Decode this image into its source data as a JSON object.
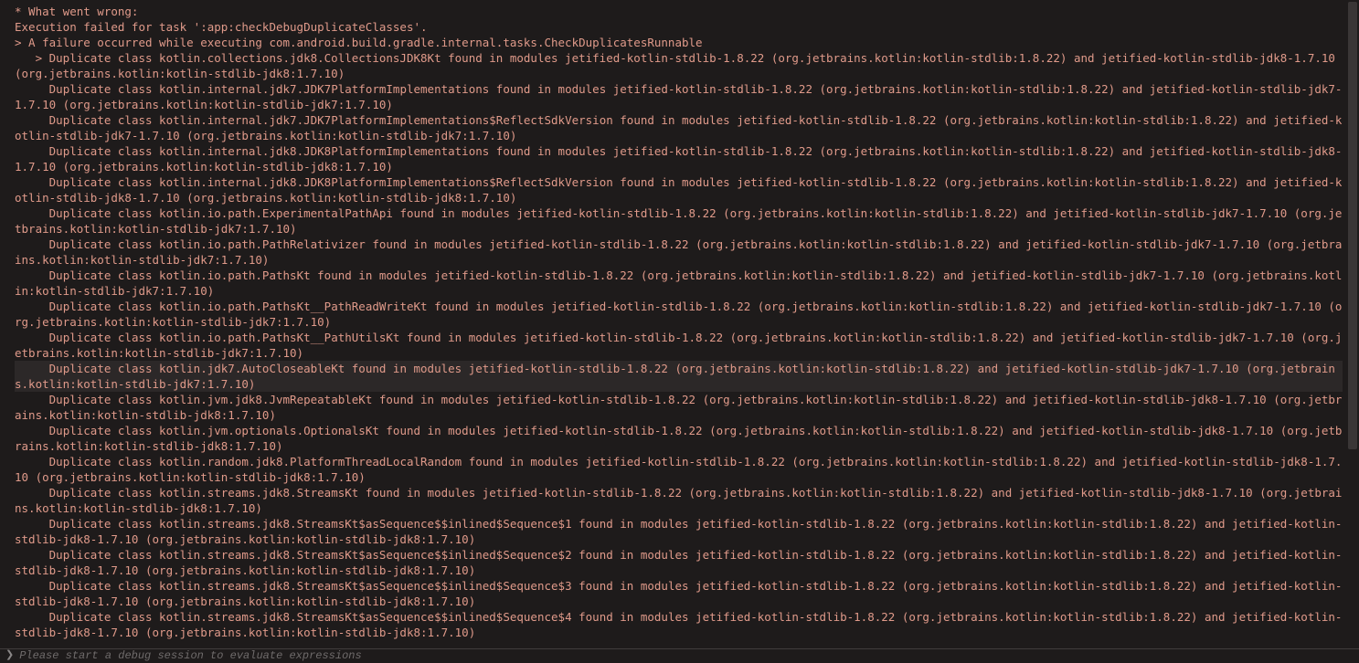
{
  "log": {
    "lines": [
      "* What went wrong:",
      "Execution failed for task ':app:checkDebugDuplicateClasses'.",
      "> A failure occurred while executing com.android.build.gradle.internal.tasks.CheckDuplicatesRunnable",
      "   > Duplicate class kotlin.collections.jdk8.CollectionsJDK8Kt found in modules jetified-kotlin-stdlib-1.8.22 (org.jetbrains.kotlin:kotlin-stdlib:1.8.22) and jetified-kotlin-stdlib-jdk8-1.7.10 (org.jetbrains.kotlin:kotlin-stdlib-jdk8:1.7.10)",
      "     Duplicate class kotlin.internal.jdk7.JDK7PlatformImplementations found in modules jetified-kotlin-stdlib-1.8.22 (org.jetbrains.kotlin:kotlin-stdlib:1.8.22) and jetified-kotlin-stdlib-jdk7-1.7.10 (org.jetbrains.kotlin:kotlin-stdlib-jdk7:1.7.10)",
      "     Duplicate class kotlin.internal.jdk7.JDK7PlatformImplementations$ReflectSdkVersion found in modules jetified-kotlin-stdlib-1.8.22 (org.jetbrains.kotlin:kotlin-stdlib:1.8.22) and jetified-kotlin-stdlib-jdk7-1.7.10 (org.jetbrains.kotlin:kotlin-stdlib-jdk7:1.7.10)",
      "     Duplicate class kotlin.internal.jdk8.JDK8PlatformImplementations found in modules jetified-kotlin-stdlib-1.8.22 (org.jetbrains.kotlin:kotlin-stdlib:1.8.22) and jetified-kotlin-stdlib-jdk8-1.7.10 (org.jetbrains.kotlin:kotlin-stdlib-jdk8:1.7.10)",
      "     Duplicate class kotlin.internal.jdk8.JDK8PlatformImplementations$ReflectSdkVersion found in modules jetified-kotlin-stdlib-1.8.22 (org.jetbrains.kotlin:kotlin-stdlib:1.8.22) and jetified-kotlin-stdlib-jdk8-1.7.10 (org.jetbrains.kotlin:kotlin-stdlib-jdk8:1.7.10)",
      "     Duplicate class kotlin.io.path.ExperimentalPathApi found in modules jetified-kotlin-stdlib-1.8.22 (org.jetbrains.kotlin:kotlin-stdlib:1.8.22) and jetified-kotlin-stdlib-jdk7-1.7.10 (org.jetbrains.kotlin:kotlin-stdlib-jdk7:1.7.10)",
      "     Duplicate class kotlin.io.path.PathRelativizer found in modules jetified-kotlin-stdlib-1.8.22 (org.jetbrains.kotlin:kotlin-stdlib:1.8.22) and jetified-kotlin-stdlib-jdk7-1.7.10 (org.jetbrains.kotlin:kotlin-stdlib-jdk7:1.7.10)",
      "     Duplicate class kotlin.io.path.PathsKt found in modules jetified-kotlin-stdlib-1.8.22 (org.jetbrains.kotlin:kotlin-stdlib:1.8.22) and jetified-kotlin-stdlib-jdk7-1.7.10 (org.jetbrains.kotlin:kotlin-stdlib-jdk7:1.7.10)",
      "     Duplicate class kotlin.io.path.PathsKt__PathReadWriteKt found in modules jetified-kotlin-stdlib-1.8.22 (org.jetbrains.kotlin:kotlin-stdlib:1.8.22) and jetified-kotlin-stdlib-jdk7-1.7.10 (org.jetbrains.kotlin:kotlin-stdlib-jdk7:1.7.10)",
      "     Duplicate class kotlin.io.path.PathsKt__PathUtilsKt found in modules jetified-kotlin-stdlib-1.8.22 (org.jetbrains.kotlin:kotlin-stdlib:1.8.22) and jetified-kotlin-stdlib-jdk7-1.7.10 (org.jetbrains.kotlin:kotlin-stdlib-jdk7:1.7.10)",
      "     Duplicate class kotlin.jdk7.AutoCloseableKt found in modules jetified-kotlin-stdlib-1.8.22 (org.jetbrains.kotlin:kotlin-stdlib:1.8.22) and jetified-kotlin-stdlib-jdk7-1.7.10 (org.jetbrains.kotlin:kotlin-stdlib-jdk7:1.7.10)",
      "     Duplicate class kotlin.jvm.jdk8.JvmRepeatableKt found in modules jetified-kotlin-stdlib-1.8.22 (org.jetbrains.kotlin:kotlin-stdlib:1.8.22) and jetified-kotlin-stdlib-jdk8-1.7.10 (org.jetbrains.kotlin:kotlin-stdlib-jdk8:1.7.10)",
      "     Duplicate class kotlin.jvm.optionals.OptionalsKt found in modules jetified-kotlin-stdlib-1.8.22 (org.jetbrains.kotlin:kotlin-stdlib:1.8.22) and jetified-kotlin-stdlib-jdk8-1.7.10 (org.jetbrains.kotlin:kotlin-stdlib-jdk8:1.7.10)",
      "     Duplicate class kotlin.random.jdk8.PlatformThreadLocalRandom found in modules jetified-kotlin-stdlib-1.8.22 (org.jetbrains.kotlin:kotlin-stdlib:1.8.22) and jetified-kotlin-stdlib-jdk8-1.7.10 (org.jetbrains.kotlin:kotlin-stdlib-jdk8:1.7.10)",
      "     Duplicate class kotlin.streams.jdk8.StreamsKt found in modules jetified-kotlin-stdlib-1.8.22 (org.jetbrains.kotlin:kotlin-stdlib:1.8.22) and jetified-kotlin-stdlib-jdk8-1.7.10 (org.jetbrains.kotlin:kotlin-stdlib-jdk8:1.7.10)",
      "     Duplicate class kotlin.streams.jdk8.StreamsKt$asSequence$$inlined$Sequence$1 found in modules jetified-kotlin-stdlib-1.8.22 (org.jetbrains.kotlin:kotlin-stdlib:1.8.22) and jetified-kotlin-stdlib-jdk8-1.7.10 (org.jetbrains.kotlin:kotlin-stdlib-jdk8:1.7.10)",
      "     Duplicate class kotlin.streams.jdk8.StreamsKt$asSequence$$inlined$Sequence$2 found in modules jetified-kotlin-stdlib-1.8.22 (org.jetbrains.kotlin:kotlin-stdlib:1.8.22) and jetified-kotlin-stdlib-jdk8-1.7.10 (org.jetbrains.kotlin:kotlin-stdlib-jdk8:1.7.10)",
      "     Duplicate class kotlin.streams.jdk8.StreamsKt$asSequence$$inlined$Sequence$3 found in modules jetified-kotlin-stdlib-1.8.22 (org.jetbrains.kotlin:kotlin-stdlib:1.8.22) and jetified-kotlin-stdlib-jdk8-1.7.10 (org.jetbrains.kotlin:kotlin-stdlib-jdk8:1.7.10)",
      "     Duplicate class kotlin.streams.jdk8.StreamsKt$asSequence$$inlined$Sequence$4 found in modules jetified-kotlin-stdlib-1.8.22 (org.jetbrains.kotlin:kotlin-stdlib:1.8.22) and jetified-kotlin-stdlib-jdk8-1.7.10 (org.jetbrains.kotlin:kotlin-stdlib-jdk8:1.7.10)"
    ],
    "highlight_index": 13
  },
  "bottom_bar": {
    "placeholder": "Please start a debug session to evaluate expressions"
  }
}
